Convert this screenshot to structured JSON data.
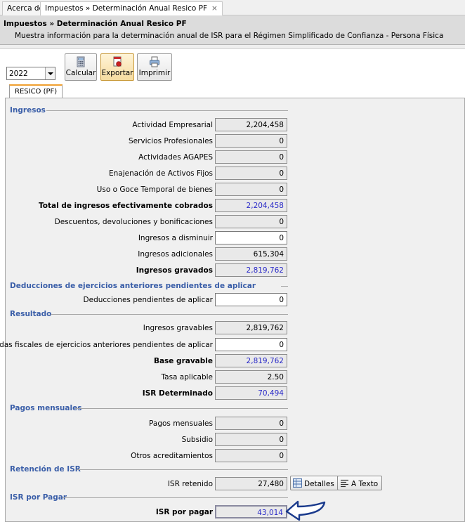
{
  "tabs": [
    {
      "label": "Acerca de"
    },
    {
      "label": "Impuestos » Determinación Anual Resico PF",
      "close": "×"
    }
  ],
  "header": {
    "title": "Impuestos » Determinación Anual Resico PF",
    "description": "Muestra información para la determinación anual de ISR para el Régimen Simplificado de Confianza - Persona Física"
  },
  "toolbar": {
    "year": "2022",
    "calcular": "Calcular",
    "exportar": "Exportar",
    "imprimir": "Imprimir"
  },
  "subtab": "RESICO (PF)",
  "sections": {
    "ingresos": "Ingresos",
    "deducciones": "Deducciones de ejercicios anteriores pendientes de aplicar",
    "resultado": "Resultado",
    "pagos": "Pagos mensuales",
    "retencion": "Retención de ISR",
    "isr_pagar": "ISR por Pagar"
  },
  "ingresos": [
    {
      "label": "Actividad Empresarial",
      "value": "2,204,458"
    },
    {
      "label": "Servicios Profesionales",
      "value": "0"
    },
    {
      "label": "Actividades AGAPES",
      "value": "0"
    },
    {
      "label": "Enajenación de Activos Fijos",
      "value": "0"
    },
    {
      "label": "Uso o Goce Temporal de bienes",
      "value": "0"
    },
    {
      "label": "Total de ingresos efectivamente cobrados",
      "value": "2,204,458"
    },
    {
      "label": "Descuentos, devoluciones y bonificaciones",
      "value": "0"
    },
    {
      "label": "Ingresos a disminuir",
      "value": "0"
    },
    {
      "label": "Ingresos adicionales",
      "value": "615,304"
    },
    {
      "label": "Ingresos gravados",
      "value": "2,819,762"
    }
  ],
  "deducciones": [
    {
      "label": "Deducciones pendientes de aplicar",
      "value": "0"
    }
  ],
  "resultado": [
    {
      "label": "Ingresos gravables",
      "value": "2,819,762"
    },
    {
      "label": "Pérdidas fiscales de ejercicios anteriores pendientes de aplicar",
      "value": "0"
    },
    {
      "label": "Base gravable",
      "value": "2,819,762"
    },
    {
      "label": "Tasa aplicable",
      "value": "2.50"
    },
    {
      "label": "ISR Determinado",
      "value": "70,494"
    }
  ],
  "pagos": [
    {
      "label": "Pagos mensuales",
      "value": "0"
    },
    {
      "label": "Subsidio",
      "value": "0"
    },
    {
      "label": "Otros acreditamientos",
      "value": "0"
    }
  ],
  "retencion": {
    "label": "ISR retenido",
    "value": "27,480",
    "detalles": "Detalles",
    "a_texto": "A Texto"
  },
  "isr_pagar": {
    "label": "ISR por pagar",
    "value": "43,014"
  },
  "colors": {
    "section_title": "#3a5ea8",
    "computed_value": "#2a2ac8",
    "arrow": "#1a3a8c"
  }
}
